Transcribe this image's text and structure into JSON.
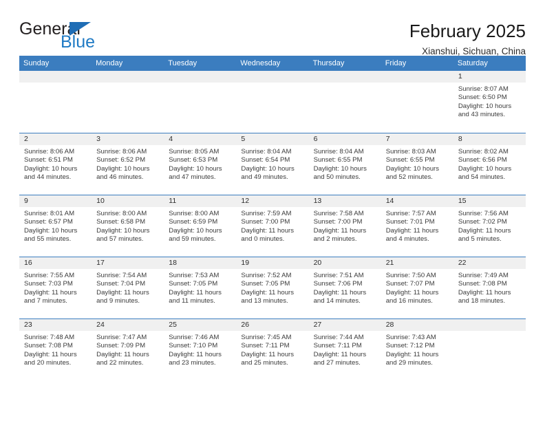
{
  "brand": {
    "word_one": "General",
    "word_two": "Blue",
    "accent_color": "#1f7ac4",
    "triangle_color": "#1f6db5"
  },
  "header": {
    "title": "February 2025",
    "subtitle": "Xianshui, Sichuan, China"
  },
  "calendar": {
    "header_bg": "#3b7dbf",
    "day_band_bg": "#f0f0f0",
    "weekdays": [
      "Sunday",
      "Monday",
      "Tuesday",
      "Wednesday",
      "Thursday",
      "Friday",
      "Saturday"
    ],
    "weeks": [
      [
        {
          "day": "",
          "sunrise": "",
          "sunset": "",
          "daylight_1": "",
          "daylight_2": ""
        },
        {
          "day": "",
          "sunrise": "",
          "sunset": "",
          "daylight_1": "",
          "daylight_2": ""
        },
        {
          "day": "",
          "sunrise": "",
          "sunset": "",
          "daylight_1": "",
          "daylight_2": ""
        },
        {
          "day": "",
          "sunrise": "",
          "sunset": "",
          "daylight_1": "",
          "daylight_2": ""
        },
        {
          "day": "",
          "sunrise": "",
          "sunset": "",
          "daylight_1": "",
          "daylight_2": ""
        },
        {
          "day": "",
          "sunrise": "",
          "sunset": "",
          "daylight_1": "",
          "daylight_2": ""
        },
        {
          "day": "1",
          "sunrise": "Sunrise: 8:07 AM",
          "sunset": "Sunset: 6:50 PM",
          "daylight_1": "Daylight: 10 hours",
          "daylight_2": "and 43 minutes."
        }
      ],
      [
        {
          "day": "2",
          "sunrise": "Sunrise: 8:06 AM",
          "sunset": "Sunset: 6:51 PM",
          "daylight_1": "Daylight: 10 hours",
          "daylight_2": "and 44 minutes."
        },
        {
          "day": "3",
          "sunrise": "Sunrise: 8:06 AM",
          "sunset": "Sunset: 6:52 PM",
          "daylight_1": "Daylight: 10 hours",
          "daylight_2": "and 46 minutes."
        },
        {
          "day": "4",
          "sunrise": "Sunrise: 8:05 AM",
          "sunset": "Sunset: 6:53 PM",
          "daylight_1": "Daylight: 10 hours",
          "daylight_2": "and 47 minutes."
        },
        {
          "day": "5",
          "sunrise": "Sunrise: 8:04 AM",
          "sunset": "Sunset: 6:54 PM",
          "daylight_1": "Daylight: 10 hours",
          "daylight_2": "and 49 minutes."
        },
        {
          "day": "6",
          "sunrise": "Sunrise: 8:04 AM",
          "sunset": "Sunset: 6:55 PM",
          "daylight_1": "Daylight: 10 hours",
          "daylight_2": "and 50 minutes."
        },
        {
          "day": "7",
          "sunrise": "Sunrise: 8:03 AM",
          "sunset": "Sunset: 6:55 PM",
          "daylight_1": "Daylight: 10 hours",
          "daylight_2": "and 52 minutes."
        },
        {
          "day": "8",
          "sunrise": "Sunrise: 8:02 AM",
          "sunset": "Sunset: 6:56 PM",
          "daylight_1": "Daylight: 10 hours",
          "daylight_2": "and 54 minutes."
        }
      ],
      [
        {
          "day": "9",
          "sunrise": "Sunrise: 8:01 AM",
          "sunset": "Sunset: 6:57 PM",
          "daylight_1": "Daylight: 10 hours",
          "daylight_2": "and 55 minutes."
        },
        {
          "day": "10",
          "sunrise": "Sunrise: 8:00 AM",
          "sunset": "Sunset: 6:58 PM",
          "daylight_1": "Daylight: 10 hours",
          "daylight_2": "and 57 minutes."
        },
        {
          "day": "11",
          "sunrise": "Sunrise: 8:00 AM",
          "sunset": "Sunset: 6:59 PM",
          "daylight_1": "Daylight: 10 hours",
          "daylight_2": "and 59 minutes."
        },
        {
          "day": "12",
          "sunrise": "Sunrise: 7:59 AM",
          "sunset": "Sunset: 7:00 PM",
          "daylight_1": "Daylight: 11 hours",
          "daylight_2": "and 0 minutes."
        },
        {
          "day": "13",
          "sunrise": "Sunrise: 7:58 AM",
          "sunset": "Sunset: 7:00 PM",
          "daylight_1": "Daylight: 11 hours",
          "daylight_2": "and 2 minutes."
        },
        {
          "day": "14",
          "sunrise": "Sunrise: 7:57 AM",
          "sunset": "Sunset: 7:01 PM",
          "daylight_1": "Daylight: 11 hours",
          "daylight_2": "and 4 minutes."
        },
        {
          "day": "15",
          "sunrise": "Sunrise: 7:56 AM",
          "sunset": "Sunset: 7:02 PM",
          "daylight_1": "Daylight: 11 hours",
          "daylight_2": "and 5 minutes."
        }
      ],
      [
        {
          "day": "16",
          "sunrise": "Sunrise: 7:55 AM",
          "sunset": "Sunset: 7:03 PM",
          "daylight_1": "Daylight: 11 hours",
          "daylight_2": "and 7 minutes."
        },
        {
          "day": "17",
          "sunrise": "Sunrise: 7:54 AM",
          "sunset": "Sunset: 7:04 PM",
          "daylight_1": "Daylight: 11 hours",
          "daylight_2": "and 9 minutes."
        },
        {
          "day": "18",
          "sunrise": "Sunrise: 7:53 AM",
          "sunset": "Sunset: 7:05 PM",
          "daylight_1": "Daylight: 11 hours",
          "daylight_2": "and 11 minutes."
        },
        {
          "day": "19",
          "sunrise": "Sunrise: 7:52 AM",
          "sunset": "Sunset: 7:05 PM",
          "daylight_1": "Daylight: 11 hours",
          "daylight_2": "and 13 minutes."
        },
        {
          "day": "20",
          "sunrise": "Sunrise: 7:51 AM",
          "sunset": "Sunset: 7:06 PM",
          "daylight_1": "Daylight: 11 hours",
          "daylight_2": "and 14 minutes."
        },
        {
          "day": "21",
          "sunrise": "Sunrise: 7:50 AM",
          "sunset": "Sunset: 7:07 PM",
          "daylight_1": "Daylight: 11 hours",
          "daylight_2": "and 16 minutes."
        },
        {
          "day": "22",
          "sunrise": "Sunrise: 7:49 AM",
          "sunset": "Sunset: 7:08 PM",
          "daylight_1": "Daylight: 11 hours",
          "daylight_2": "and 18 minutes."
        }
      ],
      [
        {
          "day": "23",
          "sunrise": "Sunrise: 7:48 AM",
          "sunset": "Sunset: 7:08 PM",
          "daylight_1": "Daylight: 11 hours",
          "daylight_2": "and 20 minutes."
        },
        {
          "day": "24",
          "sunrise": "Sunrise: 7:47 AM",
          "sunset": "Sunset: 7:09 PM",
          "daylight_1": "Daylight: 11 hours",
          "daylight_2": "and 22 minutes."
        },
        {
          "day": "25",
          "sunrise": "Sunrise: 7:46 AM",
          "sunset": "Sunset: 7:10 PM",
          "daylight_1": "Daylight: 11 hours",
          "daylight_2": "and 23 minutes."
        },
        {
          "day": "26",
          "sunrise": "Sunrise: 7:45 AM",
          "sunset": "Sunset: 7:11 PM",
          "daylight_1": "Daylight: 11 hours",
          "daylight_2": "and 25 minutes."
        },
        {
          "day": "27",
          "sunrise": "Sunrise: 7:44 AM",
          "sunset": "Sunset: 7:11 PM",
          "daylight_1": "Daylight: 11 hours",
          "daylight_2": "and 27 minutes."
        },
        {
          "day": "28",
          "sunrise": "Sunrise: 7:43 AM",
          "sunset": "Sunset: 7:12 PM",
          "daylight_1": "Daylight: 11 hours",
          "daylight_2": "and 29 minutes."
        },
        {
          "day": "",
          "sunrise": "",
          "sunset": "",
          "daylight_1": "",
          "daylight_2": ""
        }
      ]
    ]
  }
}
